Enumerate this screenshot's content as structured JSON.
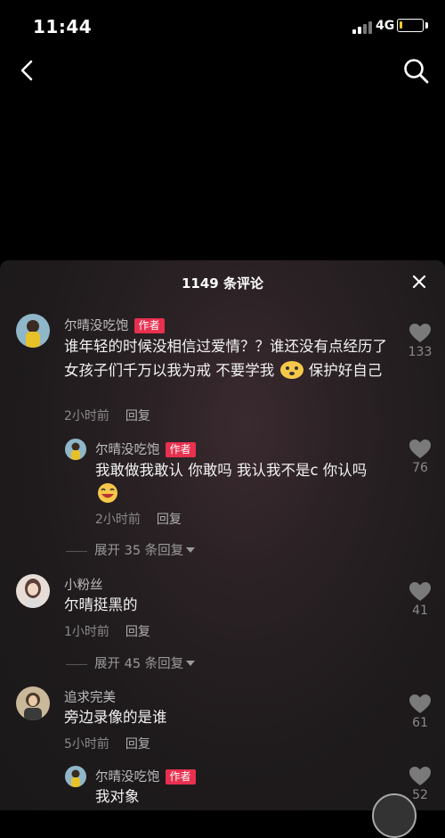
{
  "status_bar": {
    "time": "11:44",
    "network": "4G",
    "battery_level": 0.12
  },
  "nav": {
    "back_icon": "chevron-left-icon",
    "search_icon": "search-icon"
  },
  "sheet": {
    "title": "1149 条评论",
    "close_icon": "close-icon"
  },
  "comments": [
    {
      "user": "尔晴没吃饱",
      "tag": "作者",
      "text": "谁年轻的时候没相信过爱情？？谁还没有点经历了 女孩子们千万以我为戒 不要学我",
      "text_after_emoji": "保护好自己",
      "emoji": "crying-face-emoji",
      "time": "2小时前",
      "reply_label": "回复",
      "likes": "133"
    },
    {
      "user": "尔晴没吃饱",
      "tag": "作者",
      "text": "我敢做我敢认 你敢吗 我认我不是c 你认吗",
      "emoji": "grinning-face-emoji",
      "time": "2小时前",
      "reply_label": "回复",
      "likes": "76",
      "expand": "展开 35 条回复"
    },
    {
      "user": "小粉丝",
      "text": "尔晴挺黑的",
      "time": "1小时前",
      "reply_label": "回复",
      "likes": "41",
      "expand": "展开 45 条回复"
    },
    {
      "user": "追求完美",
      "text": "旁边录像的是谁",
      "time": "5小时前",
      "reply_label": "回复",
      "likes": "61"
    },
    {
      "user": "尔晴没吃饱",
      "tag": "作者",
      "text": "我对象",
      "likes": "52"
    }
  ],
  "colors": {
    "author_tag": "#e8304f",
    "battery": "#f7c82b",
    "sheet_bg": "#1f1b1d"
  }
}
